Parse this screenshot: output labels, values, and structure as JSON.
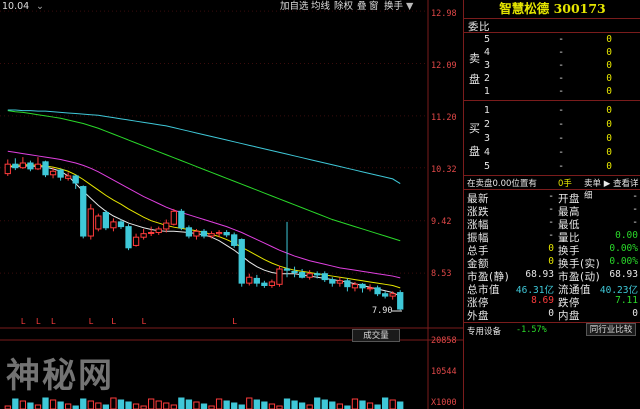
{
  "top_left_value": "10.04",
  "toolbar": {
    "add_fav": "加自选",
    "ma": "均线",
    "adj": "除权",
    "overlay": "叠",
    "window": "窗",
    "switch": "换手",
    "menu": "▼"
  },
  "price_axis": [
    "12.98",
    "12.09",
    "11.20",
    "10.32",
    "9.42",
    "8.53"
  ],
  "price_low_label": "7.90",
  "vol_axis": [
    "20858",
    "10544",
    "X1000"
  ],
  "volume_button": "成交量",
  "l_marker": "L",
  "chart_data": {
    "type": "candlestick",
    "ylim": [
      7.7,
      13.1
    ],
    "up_color": "#ff3c3c",
    "down_color": "#3fc8d8",
    "candles": [
      {
        "o": 10.22,
        "c": 10.38,
        "h": 10.46,
        "l": 10.18
      },
      {
        "o": 10.38,
        "c": 10.32,
        "h": 10.48,
        "l": 10.28
      },
      {
        "o": 10.32,
        "c": 10.4,
        "h": 10.5,
        "l": 10.3
      },
      {
        "o": 10.4,
        "c": 10.3,
        "h": 10.44,
        "l": 10.26
      },
      {
        "o": 10.3,
        "c": 10.38,
        "h": 10.5,
        "l": 10.28
      },
      {
        "o": 10.42,
        "c": 10.2,
        "h": 10.44,
        "l": 10.16
      },
      {
        "o": 10.2,
        "c": 10.26,
        "h": 10.32,
        "l": 10.14
      },
      {
        "o": 10.28,
        "c": 10.16,
        "h": 10.3,
        "l": 10.1
      },
      {
        "o": 10.14,
        "c": 10.18,
        "h": 10.24,
        "l": 10.1
      },
      {
        "o": 10.18,
        "c": 10.06,
        "h": 10.2,
        "l": 9.96
      },
      {
        "o": 10.0,
        "c": 9.16,
        "h": 10.02,
        "l": 9.12
      },
      {
        "o": 9.16,
        "c": 9.62,
        "h": 9.7,
        "l": 9.1
      },
      {
        "o": 9.28,
        "c": 9.5,
        "h": 9.54,
        "l": 9.24
      },
      {
        "o": 9.56,
        "c": 9.3,
        "h": 9.6,
        "l": 9.26
      },
      {
        "o": 9.3,
        "c": 9.4,
        "h": 9.46,
        "l": 9.24
      },
      {
        "o": 9.4,
        "c": 9.32,
        "h": 9.44,
        "l": 9.28
      },
      {
        "o": 9.32,
        "c": 8.96,
        "h": 9.36,
        "l": 8.92
      },
      {
        "o": 9.0,
        "c": 9.14,
        "h": 9.2,
        "l": 8.98
      },
      {
        "o": 9.14,
        "c": 9.2,
        "h": 9.28,
        "l": 9.1
      },
      {
        "o": 9.22,
        "c": 9.22,
        "h": 9.32,
        "l": 9.16
      },
      {
        "o": 9.22,
        "c": 9.28,
        "h": 9.32,
        "l": 9.18
      },
      {
        "o": 9.28,
        "c": 9.38,
        "h": 9.44,
        "l": 9.22
      },
      {
        "o": 9.36,
        "c": 9.58,
        "h": 9.62,
        "l": 9.34
      },
      {
        "o": 9.58,
        "c": 9.3,
        "h": 9.62,
        "l": 9.26
      },
      {
        "o": 9.3,
        "c": 9.16,
        "h": 9.34,
        "l": 9.12
      },
      {
        "o": 9.16,
        "c": 9.24,
        "h": 9.28,
        "l": 9.1
      },
      {
        "o": 9.24,
        "c": 9.16,
        "h": 9.28,
        "l": 9.12
      },
      {
        "o": 9.16,
        "c": 9.2,
        "h": 9.24,
        "l": 9.12
      },
      {
        "o": 9.2,
        "c": 9.22,
        "h": 9.26,
        "l": 9.14
      },
      {
        "o": 9.22,
        "c": 9.18,
        "h": 9.26,
        "l": 9.14
      },
      {
        "o": 9.18,
        "c": 9.0,
        "h": 9.22,
        "l": 8.96
      },
      {
        "o": 9.1,
        "c": 8.36,
        "h": 9.12,
        "l": 8.3
      },
      {
        "o": 8.36,
        "c": 8.46,
        "h": 8.52,
        "l": 8.32
      },
      {
        "o": 8.44,
        "c": 8.36,
        "h": 8.5,
        "l": 8.3
      },
      {
        "o": 8.36,
        "c": 8.32,
        "h": 8.4,
        "l": 8.28
      },
      {
        "o": 8.32,
        "c": 8.38,
        "h": 8.42,
        "l": 8.28
      },
      {
        "o": 8.34,
        "c": 8.6,
        "h": 8.66,
        "l": 8.3
      },
      {
        "o": 8.6,
        "c": 8.58,
        "h": 9.4,
        "l": 8.46
      },
      {
        "o": 8.56,
        "c": 8.54,
        "h": 8.64,
        "l": 8.46
      },
      {
        "o": 8.54,
        "c": 8.46,
        "h": 8.6,
        "l": 8.44
      },
      {
        "o": 8.46,
        "c": 8.52,
        "h": 8.58,
        "l": 8.42
      },
      {
        "o": 8.52,
        "c": 8.5,
        "h": 8.56,
        "l": 8.44
      },
      {
        "o": 8.52,
        "c": 8.42,
        "h": 8.56,
        "l": 8.38
      },
      {
        "o": 8.42,
        "c": 8.36,
        "h": 8.46,
        "l": 8.3
      },
      {
        "o": 8.36,
        "c": 8.4,
        "h": 8.46,
        "l": 8.3
      },
      {
        "o": 8.4,
        "c": 8.3,
        "h": 8.44,
        "l": 8.22
      },
      {
        "o": 8.28,
        "c": 8.34,
        "h": 8.38,
        "l": 8.22
      },
      {
        "o": 8.34,
        "c": 8.28,
        "h": 8.36,
        "l": 8.2
      },
      {
        "o": 8.28,
        "c": 8.28,
        "h": 8.34,
        "l": 8.22
      },
      {
        "o": 8.28,
        "c": 8.18,
        "h": 8.32,
        "l": 8.14
      },
      {
        "o": 8.18,
        "c": 8.14,
        "h": 8.22,
        "l": 8.1
      },
      {
        "o": 8.14,
        "c": 8.18,
        "h": 8.22,
        "l": 8.08
      },
      {
        "o": 8.2,
        "c": 7.92,
        "h": 8.24,
        "l": 7.9
      }
    ],
    "ma_lines": [
      {
        "color": "#e8e8e8",
        "values": [
          10.33,
          10.34,
          10.35,
          10.35,
          10.34,
          10.33,
          10.3,
          10.26,
          10.18,
          10.05,
          9.92,
          9.8,
          9.68,
          9.58,
          9.5,
          9.44,
          9.38,
          9.34,
          9.3,
          9.27,
          9.25,
          9.24,
          9.24,
          9.23,
          9.22,
          9.2,
          9.18,
          9.14,
          9.08,
          9.0,
          8.92,
          8.82,
          8.72,
          8.64,
          8.58,
          8.54,
          8.52,
          8.52,
          8.52,
          8.5,
          8.48,
          8.46,
          8.44,
          8.42,
          8.4,
          8.38,
          8.35,
          8.32,
          8.29,
          8.26,
          8.23,
          8.2,
          8.14
        ]
      },
      {
        "color": "#e6e600",
        "values": [
          10.34,
          10.36,
          10.37,
          10.37,
          10.36,
          10.35,
          10.33,
          10.3,
          10.26,
          10.2,
          10.12,
          10.03,
          9.94,
          9.85,
          9.77,
          9.7,
          9.62,
          9.55,
          9.48,
          9.42,
          9.38,
          9.34,
          9.31,
          9.29,
          9.27,
          9.25,
          9.22,
          9.19,
          9.15,
          9.1,
          9.04,
          8.97,
          8.9,
          8.83,
          8.76,
          8.7,
          8.65,
          8.61,
          8.58,
          8.56,
          8.54,
          8.52,
          8.5,
          8.48,
          8.46,
          8.44,
          8.42,
          8.4,
          8.38,
          8.36,
          8.34,
          8.32,
          8.28
        ]
      },
      {
        "color": "#e040e0",
        "values": [
          10.6,
          10.58,
          10.56,
          10.54,
          10.52,
          10.5,
          10.48,
          10.46,
          10.43,
          10.4,
          10.36,
          10.31,
          10.25,
          10.18,
          10.11,
          10.04,
          9.97,
          9.9,
          9.83,
          9.77,
          9.71,
          9.65,
          9.6,
          9.56,
          9.52,
          9.48,
          9.44,
          9.4,
          9.36,
          9.32,
          9.27,
          9.22,
          9.16,
          9.1,
          9.04,
          8.98,
          8.92,
          8.87,
          8.82,
          8.78,
          8.74,
          8.71,
          8.68,
          8.65,
          8.62,
          8.6,
          8.58,
          8.56,
          8.54,
          8.52,
          8.5,
          8.48,
          8.45
        ]
      },
      {
        "color": "#2ad92a",
        "values": [
          11.29,
          11.27,
          11.26,
          11.24,
          11.22,
          11.2,
          11.18,
          11.16,
          11.13,
          11.1,
          11.07,
          11.03,
          10.99,
          10.94,
          10.89,
          10.84,
          10.79,
          10.74,
          10.69,
          10.64,
          10.59,
          10.54,
          10.49,
          10.44,
          10.39,
          10.34,
          10.29,
          10.24,
          10.19,
          10.14,
          10.09,
          10.04,
          9.99,
          9.94,
          9.89,
          9.84,
          9.79,
          9.74,
          9.69,
          9.64,
          9.59,
          9.54,
          9.49,
          9.44,
          9.4,
          9.36,
          9.32,
          9.28,
          9.24,
          9.2,
          9.16,
          9.12,
          9.08
        ]
      },
      {
        "color": "#3fc8d8",
        "values": [
          11.3,
          11.3,
          11.29,
          11.29,
          11.28,
          11.28,
          11.27,
          11.26,
          11.25,
          11.24,
          11.23,
          11.22,
          11.21,
          11.19,
          11.17,
          11.15,
          11.13,
          11.11,
          11.09,
          11.07,
          11.05,
          11.03,
          11.0,
          10.97,
          10.94,
          10.91,
          10.88,
          10.85,
          10.82,
          10.79,
          10.76,
          10.73,
          10.7,
          10.67,
          10.64,
          10.61,
          10.58,
          10.55,
          10.52,
          10.49,
          10.46,
          10.43,
          10.4,
          10.37,
          10.34,
          10.31,
          10.28,
          10.25,
          10.22,
          10.19,
          10.16,
          10.13,
          10.05
        ]
      }
    ],
    "l_marker_candles": [
      2,
      4,
      6,
      11,
      14,
      18,
      30
    ]
  },
  "quote": {
    "title": "智慧松德  300173",
    "wei_bi": "委比",
    "sell_label": [
      "卖",
      "盘"
    ],
    "buy_label": [
      "买",
      "盘"
    ],
    "sell_rows": [
      {
        "level": "5",
        "price": "-",
        "vol": "0"
      },
      {
        "level": "4",
        "price": "-",
        "vol": "0"
      },
      {
        "level": "3",
        "price": "-",
        "vol": "0"
      },
      {
        "level": "2",
        "price": "-",
        "vol": "0"
      },
      {
        "level": "1",
        "price": "-",
        "vol": "0"
      }
    ],
    "buy_rows": [
      {
        "level": "1",
        "price": "-",
        "vol": "0"
      },
      {
        "level": "2",
        "price": "-",
        "vol": "0"
      },
      {
        "level": "3",
        "price": "-",
        "vol": "0"
      },
      {
        "level": "4",
        "price": "-",
        "vol": "0"
      },
      {
        "level": "5",
        "price": "-",
        "vol": "0"
      }
    ],
    "pending_left": "在卖盘0.00位置有",
    "pending_mid": "0手",
    "pending_right": "卖单 ▶ 查看详细",
    "stats": [
      {
        "k1": "最新",
        "v1": "-",
        "k2": "开盘",
        "v2": "-"
      },
      {
        "k1": "涨跌",
        "v1": "-",
        "k2": "最高",
        "v2": "-"
      },
      {
        "k1": "涨幅",
        "v1": "-",
        "k2": "最低",
        "v2": "-"
      },
      {
        "k1": "振幅",
        "v1": "-",
        "k2": "量比",
        "v2": "0.00"
      },
      {
        "k1": "总手",
        "v1": "0",
        "k2": "换手",
        "v2": "0.00%"
      },
      {
        "k1": "金额",
        "v1": "0",
        "k2": "换手(实)",
        "v2": "0.00%"
      },
      {
        "k1": "市盈(静)",
        "v1": "68.93",
        "k2": "市盈(动)",
        "v2": "68.93"
      },
      {
        "k1": "总市值",
        "v1": "46.31亿",
        "k2": "流通值",
        "v2": "40.23亿"
      },
      {
        "k1": "涨停",
        "v1": "8.69",
        "k2": "跌停",
        "v2": "7.11"
      },
      {
        "k1": "外盘",
        "v1": "0",
        "k2": "内盘",
        "v2": "0"
      }
    ],
    "bottom_label": "专用设备",
    "bottom_pct": "-1.57%",
    "bottom_button": "同行业比较"
  },
  "watermark": "神秘网",
  "colors": {
    "red": "#ff3c3c",
    "green": "#2ad92a",
    "cyan": "#3fc8d8",
    "yellow": "#e6e600",
    "border": "#7a1c1c"
  }
}
